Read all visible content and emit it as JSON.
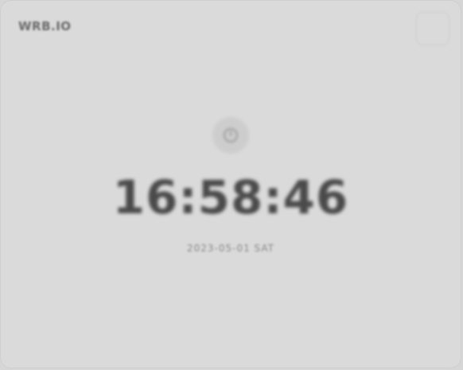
{
  "app": {
    "brand": "WRB.IO"
  },
  "clock": {
    "time": "16:58:46",
    "date": "2023-05-01 SAT"
  }
}
